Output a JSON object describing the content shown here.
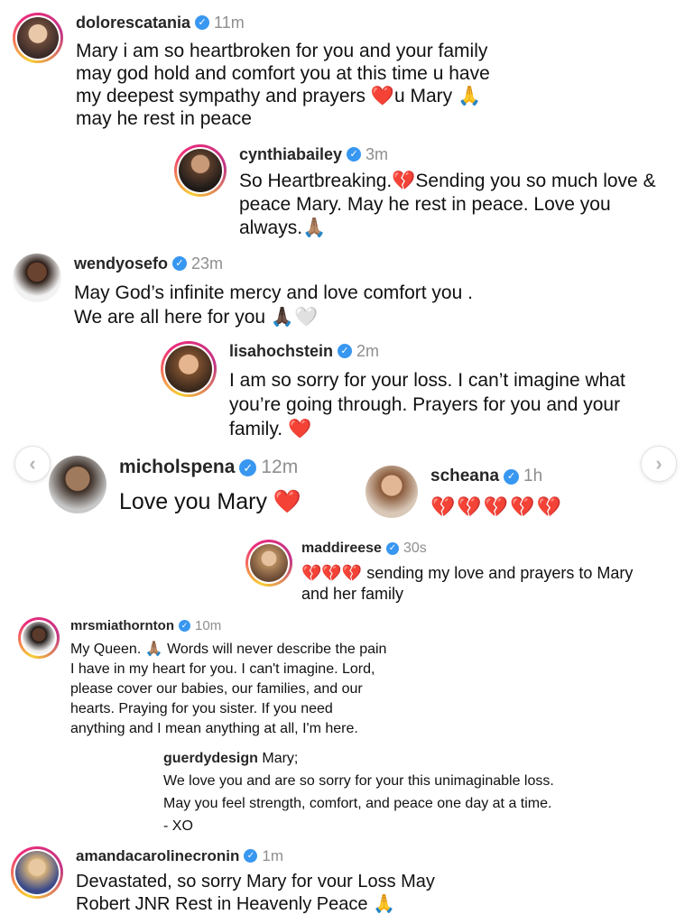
{
  "comments": [
    {
      "username": "dolorescatania",
      "time": "11m",
      "lines": [
        "Mary i am so heartbroken for you and your family",
        "may god hold and comfort you at this time u have",
        "my deepest sympathy and prayers ❤️u Mary 🙏",
        "may he rest in peace"
      ]
    },
    {
      "username": "cynthiabailey",
      "time": "3m",
      "lines": [
        "So Heartbreaking.💔Sending you so much love &",
        "peace Mary. May he rest in peace. Love you",
        "always.🙏🏽"
      ]
    },
    {
      "username": "wendyosefo",
      "time": "23m",
      "lines": [
        "May God’s infinite mercy and love comfort you .",
        "We are all here for you 🙏🏿🤍"
      ]
    },
    {
      "username": "lisahochstein",
      "time": "2m",
      "lines": [
        "I am so sorry for your loss. I can’t imagine what",
        "you’re going through. Prayers for you and your",
        "family. ❤️"
      ]
    },
    {
      "username": "micholspena",
      "time": "12m",
      "lines": [
        "Love you Mary ❤️"
      ]
    },
    {
      "username": "scheana",
      "time": "1h",
      "lines": [
        "💔💔💔💔💔"
      ]
    },
    {
      "username": "maddireese",
      "time": "30s",
      "lines": [
        "💔💔💔 sending my love and prayers to Mary",
        "and her family"
      ]
    },
    {
      "username": "mrsmiathornton",
      "time": "10m",
      "lines": [
        "My Queen. 🙏🏽 Words will never describe the pain",
        "I have in my heart for you.  I can't imagine.  Lord,",
        "please cover our babies, our families, and our",
        "hearts.  Praying for you sister.  If you need",
        "anything and I mean anything at all, I'm here."
      ]
    },
    {
      "username": "guerdydesign",
      "time": "",
      "lines": [
        "Mary;",
        "We love you and are so sorry for your this unimaginable loss.",
        "May you feel strength, comfort, and peace one day at a time.",
        "- XO"
      ]
    },
    {
      "username": "amandacarolinecronin",
      "time": "1m",
      "lines": [
        "Devastated, so sorry Mary for vour Loss May",
        "Robert JNR Rest in Heavenly Peace 🙏"
      ]
    }
  ],
  "nav": {
    "prev_icon": "‹",
    "next_icon": "›"
  },
  "colors": {
    "verified": "#3897f0",
    "heart": "#e0162b",
    "ring_start": "#f9ce34",
    "ring_end": "#c13584"
  }
}
